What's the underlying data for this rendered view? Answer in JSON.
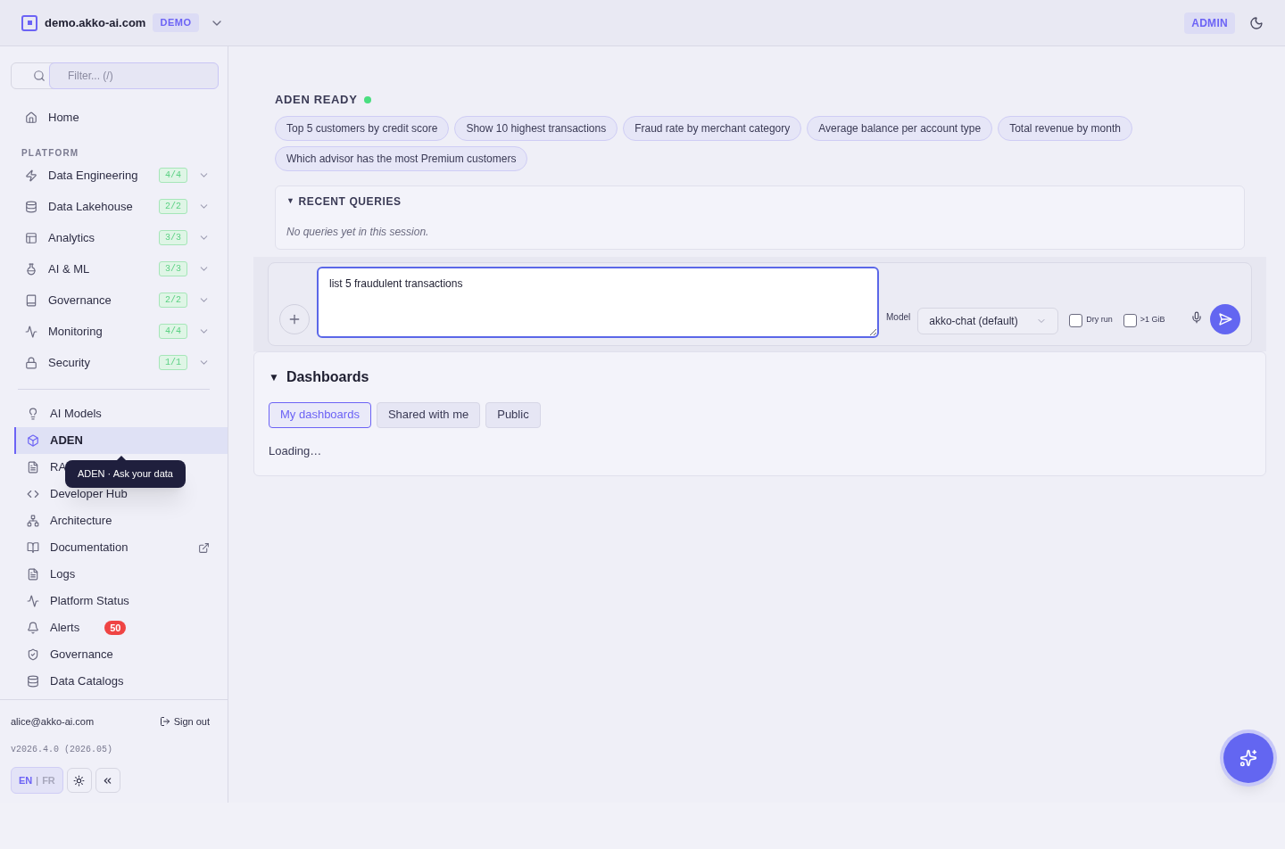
{
  "header": {
    "domain": "demo.akko-ai.com",
    "env_badge": "DEMO",
    "role_badge": "ADMIN"
  },
  "sidebar": {
    "filter": {
      "placeholder": "Filter... (/)"
    },
    "home": {
      "label": "Home",
      "selected": false
    },
    "section_label": "PLATFORM",
    "platform_items": [
      {
        "label": "Data Engineering",
        "count": "4/4",
        "expanded": false
      },
      {
        "label": "Data Lakehouse",
        "count": "2/2",
        "expanded": false
      },
      {
        "label": "Analytics",
        "count": "3/3",
        "expanded": false
      },
      {
        "label": "AI & ML",
        "count": "3/3",
        "expanded": false
      },
      {
        "label": "Governance",
        "count": "2/2",
        "expanded": false
      },
      {
        "label": "Monitoring",
        "count": "4/4",
        "expanded": false
      },
      {
        "label": "Security",
        "count": "1/1",
        "expanded": false
      }
    ],
    "items": [
      {
        "label": "AI Models",
        "selected": false
      },
      {
        "label": "ADEN",
        "selected": true
      },
      {
        "label": "RA",
        "selected": false
      },
      {
        "label": "Developer Hub",
        "selected": false
      },
      {
        "label": "Architecture",
        "selected": false
      },
      {
        "label": "Documentation",
        "selected": false,
        "external": true
      },
      {
        "label": "Logs",
        "selected": false
      },
      {
        "label": "Platform Status",
        "selected": false
      },
      {
        "label": "Alerts",
        "selected": false,
        "badge": "50"
      },
      {
        "label": "Governance",
        "selected": false
      },
      {
        "label": "Data Catalogs",
        "selected": false
      }
    ],
    "tooltip": "ADEN · Ask your data",
    "footer": {
      "email": "alice@akko-ai.com",
      "sign_out": "Sign out",
      "version": "v2026.4.0 (2026.05)",
      "languages": [
        {
          "label": "EN",
          "selected": true
        },
        {
          "label": "FR",
          "selected": false
        }
      ],
      "separator": "|"
    }
  },
  "main": {
    "status": {
      "label": "ADEN READY",
      "color": "#4ade80"
    },
    "suggestions": [
      "Top 5 customers by credit score",
      "Show 10 highest transactions",
      "Fraud rate by merchant category",
      "Average balance per account type",
      "Total revenue by month",
      "Which advisor has the most Premium customers"
    ],
    "recent_queries": {
      "toggle_icon": "▼",
      "title": "RECENT QUERIES",
      "expanded": true,
      "empty_text": "No queries yet in this session."
    },
    "composer": {
      "value": "list 5 fraudulent transactions",
      "model_label": "Model",
      "model": "akko-chat (default)",
      "options": [
        {
          "label": "Dry run",
          "checked": false
        },
        {
          "label": ">1 GiB",
          "checked": false
        }
      ]
    },
    "dashboards": {
      "toggle_icon": "▼",
      "title": "Dashboards",
      "expanded": true,
      "tabs": [
        {
          "label": "My dashboards",
          "selected": true
        },
        {
          "label": "Shared with me",
          "selected": false
        },
        {
          "label": "Public",
          "selected": false
        }
      ],
      "status": "Loading…"
    }
  }
}
